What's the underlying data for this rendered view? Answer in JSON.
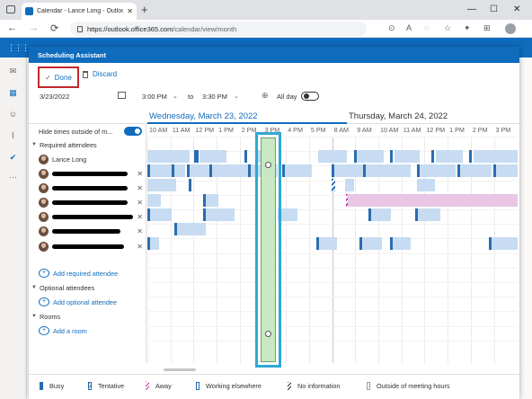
{
  "browser": {
    "tab_title": "Calendar - Lance Long - Outlook",
    "tab_close": "✕",
    "new_tab": "+",
    "url_domain": "https://outlook.office365.com",
    "url_path": "/calendar/view/month",
    "back": "←",
    "forward": "→",
    "reload": "⟳",
    "min": "—",
    "max": "☐",
    "close": "✕"
  },
  "dialog": {
    "title": "Scheduling Assistant",
    "done_label": "Done",
    "discard_label": "Discard",
    "date": "3/23/2022",
    "start_time": "3:00 PM",
    "to_label": "to",
    "end_time": "3:30 PM",
    "all_day_label": "All day",
    "all_day_on": false,
    "day1_label": "Wednesday, March 23, 2022",
    "day2_label": "Thursday, March 24, 2022"
  },
  "left_pane": {
    "hide_times_label": "Hide times outside of m...",
    "hide_times_on": true,
    "required_header": "Required attendees",
    "organizer": "Lance Long",
    "add_required": "Add required attendee",
    "optional_header": "Optional attendees",
    "add_optional": "Add optional attendee",
    "rooms_header": "Rooms",
    "add_room": "Add a room"
  },
  "hours": [
    "10 AM",
    "11 AM",
    "12 PM",
    "1 PM",
    "2 PM",
    "3 PM",
    "4 PM",
    "5 PM",
    "8 AM",
    "9 AM",
    "10 AM",
    "11 AM",
    "12 PM",
    "1 PM",
    "2 PM",
    "3 PM"
  ],
  "legend": {
    "busy": "Busy",
    "tentative": "Tentative",
    "away": "Away",
    "working_elsewhere": "Working elsewhere",
    "no_information": "No information",
    "outside_hours": "Outside of meeting hours"
  },
  "colors": {
    "accent": "#0f6cbd",
    "busy": "#2b6cb0",
    "busy_light": "#c7dcf2",
    "away": "#c239b3",
    "selection_border": "#2fa8d6",
    "selection_fill": "#c7e8c2",
    "highlight_red": "#c1272d"
  }
}
